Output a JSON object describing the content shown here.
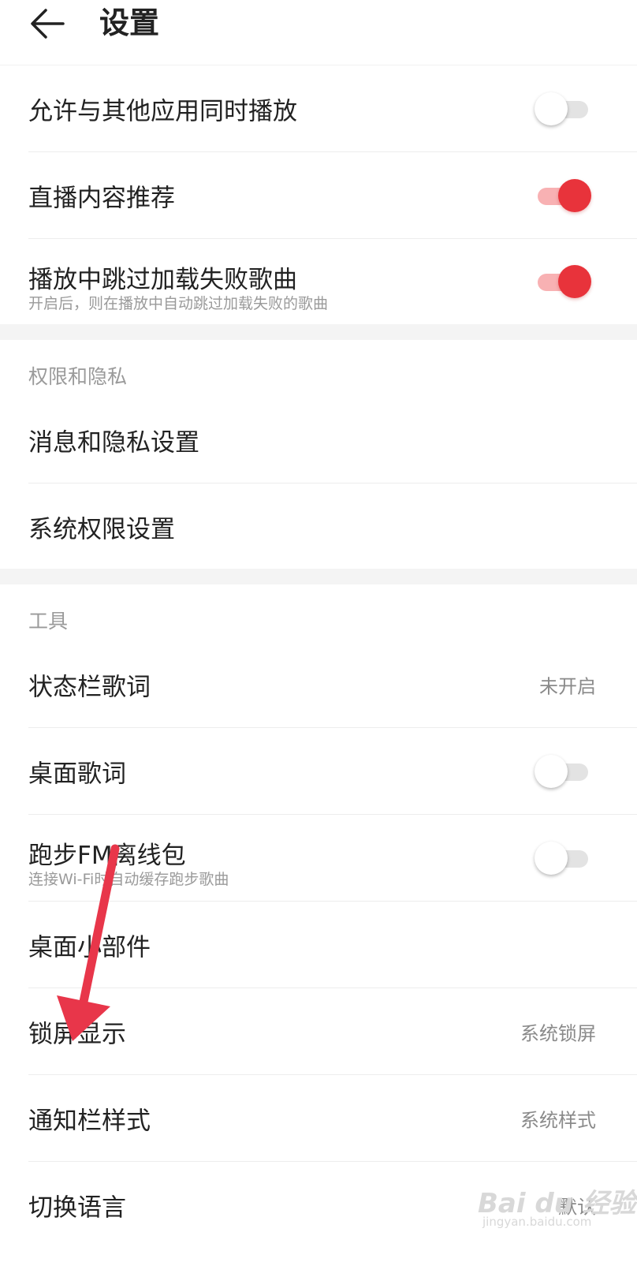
{
  "header": {
    "title": "设置"
  },
  "rows_top": [
    {
      "label": "允许与其他应用同时播放",
      "toggle": "off"
    },
    {
      "label": "直播内容推荐",
      "toggle": "on"
    },
    {
      "label": "播放中跳过加载失败歌曲",
      "sub": "开启后，则在播放中自动跳过加载失败的歌曲",
      "toggle": "on"
    }
  ],
  "privacy": {
    "header": "权限和隐私",
    "items": [
      {
        "label": "消息和隐私设置"
      },
      {
        "label": "系统权限设置"
      }
    ]
  },
  "tools": {
    "header": "工具",
    "items": [
      {
        "label": "状态栏歌词",
        "value": "未开启"
      },
      {
        "label": "桌面歌词",
        "toggle": "off"
      },
      {
        "label": "跑步FM离线包",
        "sub": "连接Wi-Fi时自动缓存跑步歌曲",
        "toggle": "off"
      },
      {
        "label": "桌面小部件"
      },
      {
        "label": "锁屏显示",
        "value": "系统锁屏"
      },
      {
        "label": "通知栏样式",
        "value": "系统样式"
      },
      {
        "label": "切换语言",
        "value": "默认"
      }
    ]
  },
  "watermark": {
    "text": "Bai du 经验",
    "sub": "jingyan.baidu.com"
  },
  "colors": {
    "accent": "#e8333b",
    "annotation_arrow": "#e8364a"
  }
}
